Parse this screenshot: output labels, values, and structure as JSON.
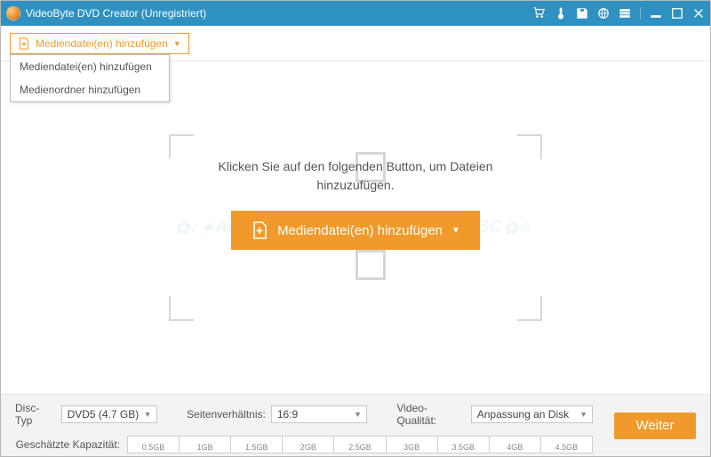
{
  "title": "VideoByte DVD Creator (Unregistriert)",
  "toolbar": {
    "add_label": "Mediendatei(en) hinzufügen",
    "dropdown": {
      "item_files": "Mediendatei(en) hinzufügen",
      "item_folder": "Medienordner hinzufügen"
    }
  },
  "main": {
    "hint_line1": "Klicken Sie auf den folgenden Button, um Dateien",
    "hint_line2": "hinzuzufügen.",
    "big_button": "Mediendatei(en) hinzufügen"
  },
  "bottom": {
    "disc_type_label": "Disc-Typ",
    "disc_type_value": "DVD5 (4.7 GB)",
    "aspect_label": "Seitenverhältnis:",
    "aspect_value": "16:9",
    "quality_label": "Video-Qualität:",
    "quality_value": "Anpassung an Disk",
    "capacity_label": "Geschätzte Kapazität:",
    "ticks": [
      "0.5GB",
      "1GB",
      "1.5GB",
      "2GB",
      "2.5GB",
      "3GB",
      "3.5GB",
      "4GB",
      "4.5GB"
    ],
    "next": "Weiter"
  }
}
